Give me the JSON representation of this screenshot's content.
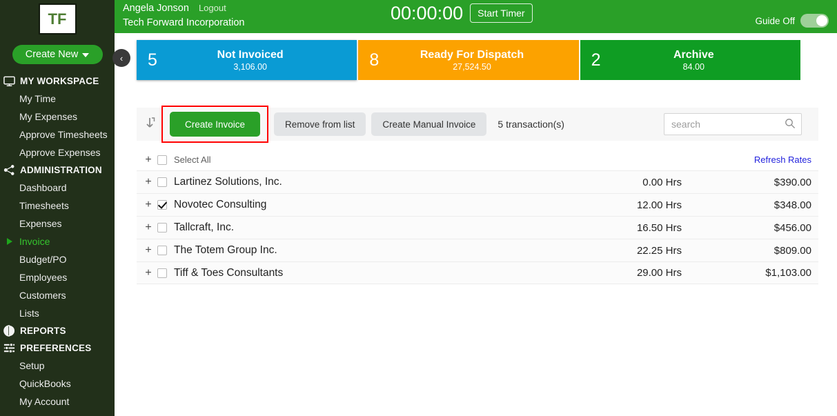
{
  "sidebar": {
    "logo": "TF",
    "create_new_label": "Create New",
    "sections": [
      {
        "icon": "monitor-icon",
        "label": "MY WORKSPACE",
        "items": [
          {
            "label": "My Time",
            "active": false
          },
          {
            "label": "My Expenses",
            "active": false
          },
          {
            "label": "Approve Timesheets",
            "active": false
          },
          {
            "label": "Approve Expenses",
            "active": false
          }
        ]
      },
      {
        "icon": "share-nodes-icon",
        "label": "ADMINISTRATION",
        "items": [
          {
            "label": "Dashboard",
            "active": false
          },
          {
            "label": "Timesheets",
            "active": false
          },
          {
            "label": "Expenses",
            "active": false
          },
          {
            "label": "Invoice",
            "active": true
          },
          {
            "label": "Budget/PO",
            "active": false
          },
          {
            "label": "Employees",
            "active": false
          },
          {
            "label": "Customers",
            "active": false
          },
          {
            "label": "Lists",
            "active": false
          }
        ]
      },
      {
        "icon": "pie-chart-icon",
        "label": "REPORTS",
        "items": []
      },
      {
        "icon": "sliders-icon",
        "label": "PREFERENCES",
        "items": [
          {
            "label": "Setup",
            "active": false
          },
          {
            "label": "QuickBooks",
            "active": false
          },
          {
            "label": "My Account",
            "active": false
          }
        ]
      }
    ]
  },
  "collapse_handle": {
    "icon": "chevron-left-icon",
    "glyph": "‹"
  },
  "header": {
    "user_name": "Angela Jonson",
    "logout_label": "Logout",
    "company": "Tech Forward Incorporation",
    "timer": "00:00:00",
    "start_timer_label": "Start Timer",
    "guide_label": "Guide Off",
    "guide_state": "off"
  },
  "tiles": [
    {
      "count": "5",
      "title": "Not Invoiced",
      "amount": "3,106.00",
      "color": "#0a9bd4"
    },
    {
      "count": "8",
      "title": "Ready For Dispatch",
      "amount": "27,524.50",
      "color": "#fca200"
    },
    {
      "count": "2",
      "title": "Archive",
      "amount": "84.00",
      "color": "#0f9d23"
    }
  ],
  "toolbar": {
    "sort_icon": "sort-down-icon",
    "create_invoice_label": "Create Invoice",
    "remove_from_list_label": "Remove from list",
    "create_manual_invoice_label": "Create Manual Invoice",
    "transaction_count": "5 transaction(s)",
    "highlight_color": "#ff0000"
  },
  "search": {
    "value": "",
    "placeholder": "search",
    "icon": "search-icon"
  },
  "table": {
    "select_all_label": "Select All",
    "select_all_checked": false,
    "refresh_rates_label": "Refresh Rates",
    "rows": [
      {
        "name": "Lartinez Solutions, Inc.",
        "hours": "0.00 Hrs",
        "amount": "$390.00",
        "checked": false
      },
      {
        "name": "Novotec Consulting",
        "hours": "12.00 Hrs",
        "amount": "$348.00",
        "checked": true
      },
      {
        "name": "Tallcraft, Inc.",
        "hours": "16.50 Hrs",
        "amount": "$456.00",
        "checked": false
      },
      {
        "name": "The Totem Group Inc.",
        "hours": "22.25 Hrs",
        "amount": "$809.00",
        "checked": false
      },
      {
        "name": "Tiff & Toes Consultants",
        "hours": "29.00 Hrs",
        "amount": "$1,103.00",
        "checked": false
      }
    ]
  }
}
